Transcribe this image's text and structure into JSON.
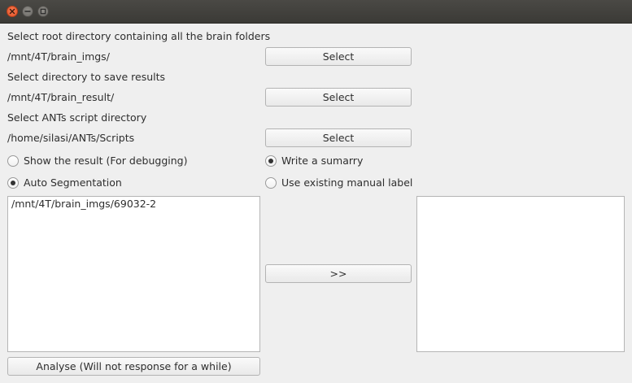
{
  "window": {
    "controls": {
      "close_icon": "close-icon",
      "minimize_icon": "minimize-icon",
      "maximize_icon": "maximize-icon"
    }
  },
  "root_dir": {
    "label": "Select root directory containing all the brain folders",
    "path": "/mnt/4T/brain_imgs/",
    "button": "Select"
  },
  "save_dir": {
    "label": "Select directory to save results",
    "path": "/mnt/4T/brain_result/",
    "button": "Select"
  },
  "ants_dir": {
    "label": "Select ANTs script directory",
    "path": "/home/silasi/ANTs/Scripts",
    "button": "Select"
  },
  "options": {
    "show_result": {
      "label": "Show the result (For debugging)",
      "checked": false
    },
    "write_summary": {
      "label": "Write a sumarry",
      "checked": true
    },
    "auto_segmentation": {
      "label": "Auto Segmentation",
      "checked": true
    },
    "use_manual_label": {
      "label": "Use existing manual label",
      "checked": false
    }
  },
  "source_list": {
    "items": [
      "/mnt/4T/brain_imgs/69032-2"
    ]
  },
  "target_list": {
    "items": []
  },
  "transfer_button": ">>",
  "analyse_button": "Analyse (Will not response for a while)",
  "colors": {
    "background": "#efefef",
    "titlebar": "#3c3b37",
    "close_button": "#e9592e"
  }
}
